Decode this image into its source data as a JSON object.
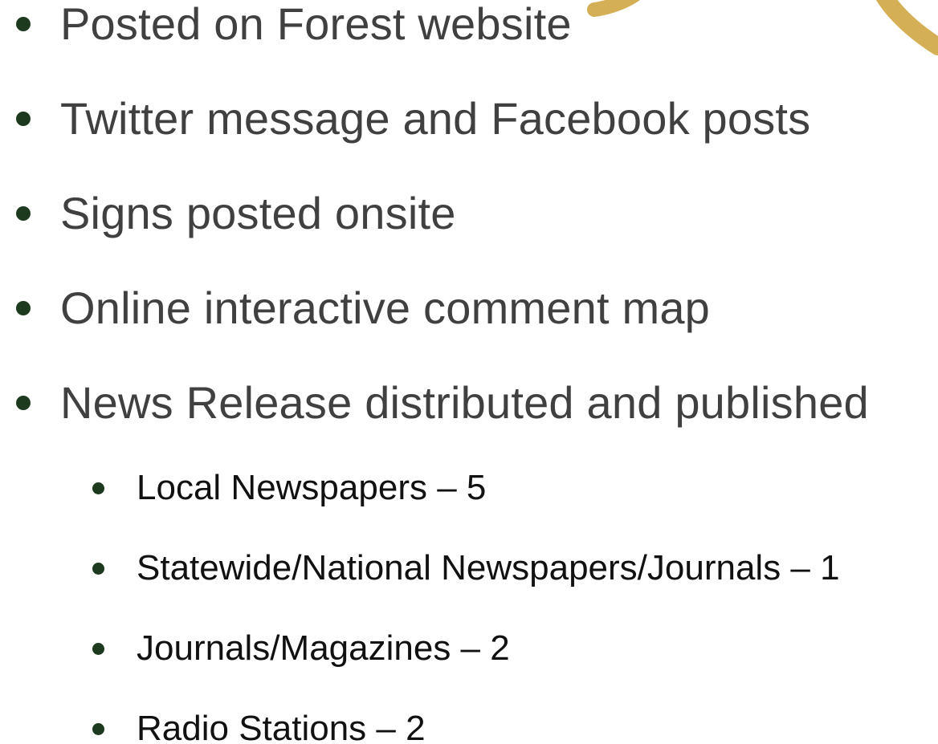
{
  "bullets": [
    "Posted on Forest website",
    "Twitter message and Facebook posts",
    "Signs posted onsite",
    "Online interactive comment map",
    "News Release distributed and published"
  ],
  "sub_bullets": [
    "Local Newspapers – 5",
    "Statewide/National Newspapers/Journals – 1",
    "Journals/Magazines – 2",
    "Radio Stations – 2"
  ],
  "colors": {
    "accent_gold": "#D4AF55",
    "bullet_dot": "#1E3A1E",
    "main_text": "#404040",
    "sub_text": "#111111"
  }
}
